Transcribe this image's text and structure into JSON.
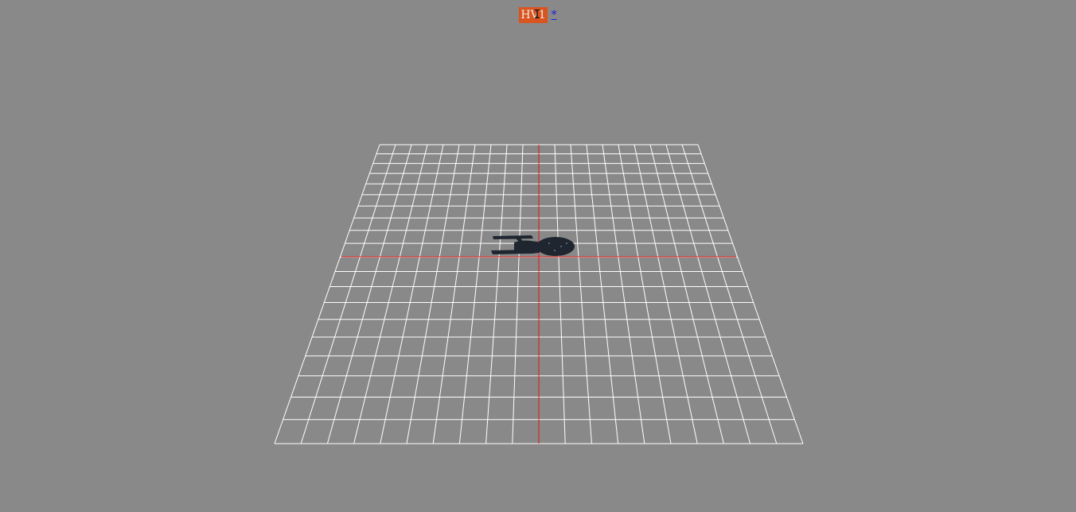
{
  "header": {
    "title": "HV1",
    "modified_marker": "*"
  },
  "scene": {
    "background_color": "#898989",
    "grid_color": "#ffffff",
    "axis_color": "#e01818",
    "ship_color": "#1f2630",
    "grid_divisions": 20,
    "cursor_icon": "text-cursor-icon"
  }
}
